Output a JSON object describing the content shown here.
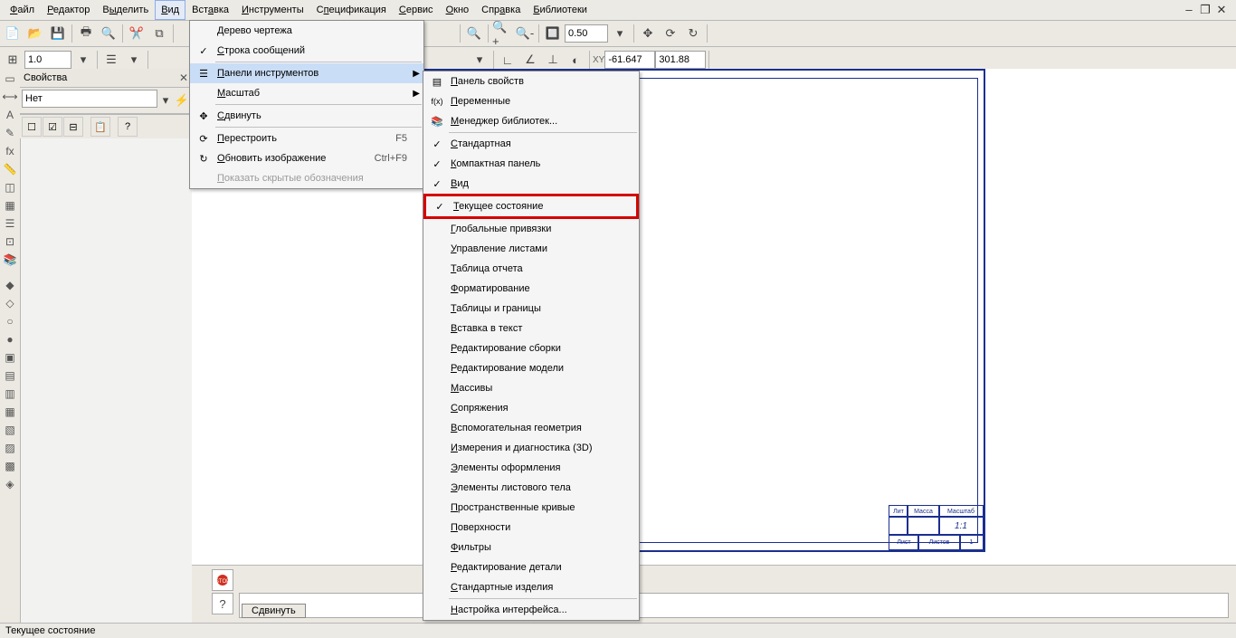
{
  "menubar": {
    "items": [
      "Файл",
      "Редактор",
      "Выделить",
      "Вид",
      "Вставка",
      "Инструменты",
      "Спецификация",
      "Сервис",
      "Окно",
      "Справка",
      "Библиотеки"
    ],
    "active_index": 3
  },
  "window_controls": {
    "min": "–",
    "max": "❐",
    "close": "✕"
  },
  "toolbar1": {
    "scale_value": "1.0",
    "zoom_value": "0.50",
    "coord_x": "-61.647",
    "coord_y": "301.88"
  },
  "properties_panel": {
    "title": "Свойства",
    "dropdown_value": "Нет"
  },
  "menu_view": {
    "items": [
      {
        "label": "Дерево чертежа",
        "icon": ""
      },
      {
        "label": "Строка сообщений",
        "check": true
      },
      {
        "sep": true
      },
      {
        "label": "Панели инструментов",
        "icon": "bars",
        "arrow": true,
        "highlight": true
      },
      {
        "label": "Масштаб",
        "arrow": true
      },
      {
        "sep": true
      },
      {
        "label": "Сдвинуть",
        "icon": "move"
      },
      {
        "sep": true
      },
      {
        "label": "Перестроить",
        "icon": "rebuild",
        "shortcut": "F5"
      },
      {
        "label": "Обновить изображение",
        "icon": "refresh",
        "shortcut": "Ctrl+F9"
      },
      {
        "label": "Показать скрытые обозначения",
        "disabled": true
      }
    ]
  },
  "submenu_panels": {
    "items": [
      {
        "label": "Панель свойств",
        "icon": "props"
      },
      {
        "label": "Переменные",
        "icon": "fx"
      },
      {
        "label": "Менеджер библиотек...",
        "icon": "lib"
      },
      {
        "sep": true
      },
      {
        "label": "Стандартная",
        "check": true
      },
      {
        "label": "Компактная панель",
        "check": true
      },
      {
        "label": "Вид",
        "check": true
      },
      {
        "label": "Текущее состояние",
        "check": true,
        "redbox": true
      },
      {
        "label": "Глобальные привязки"
      },
      {
        "label": "Управление листами"
      },
      {
        "label": "Таблица отчета"
      },
      {
        "label": "Форматирование"
      },
      {
        "label": "Таблицы и границы"
      },
      {
        "label": "Вставка в текст"
      },
      {
        "label": "Редактирование сборки"
      },
      {
        "label": "Редактирование модели"
      },
      {
        "label": "Массивы"
      },
      {
        "label": "Сопряжения"
      },
      {
        "label": "Вспомогательная геометрия"
      },
      {
        "label": "Измерения и диагностика (3D)"
      },
      {
        "label": "Элементы оформления"
      },
      {
        "label": "Элементы листового тела"
      },
      {
        "label": "Пространственные кривые"
      },
      {
        "label": "Поверхности"
      },
      {
        "label": "Фильтры"
      },
      {
        "label": "Редактирование детали"
      },
      {
        "label": "Стандартные изделия"
      },
      {
        "sep": true
      },
      {
        "label": "Настройка интерфейса..."
      }
    ]
  },
  "titleblock": {
    "cells": [
      "Лит",
      "Масса",
      "Масштаб",
      "1:1",
      "Лист",
      "Листов",
      "1"
    ]
  },
  "bottom": {
    "button": "Сдвинуть"
  },
  "statusbar": {
    "text": "Текущее состояние"
  }
}
